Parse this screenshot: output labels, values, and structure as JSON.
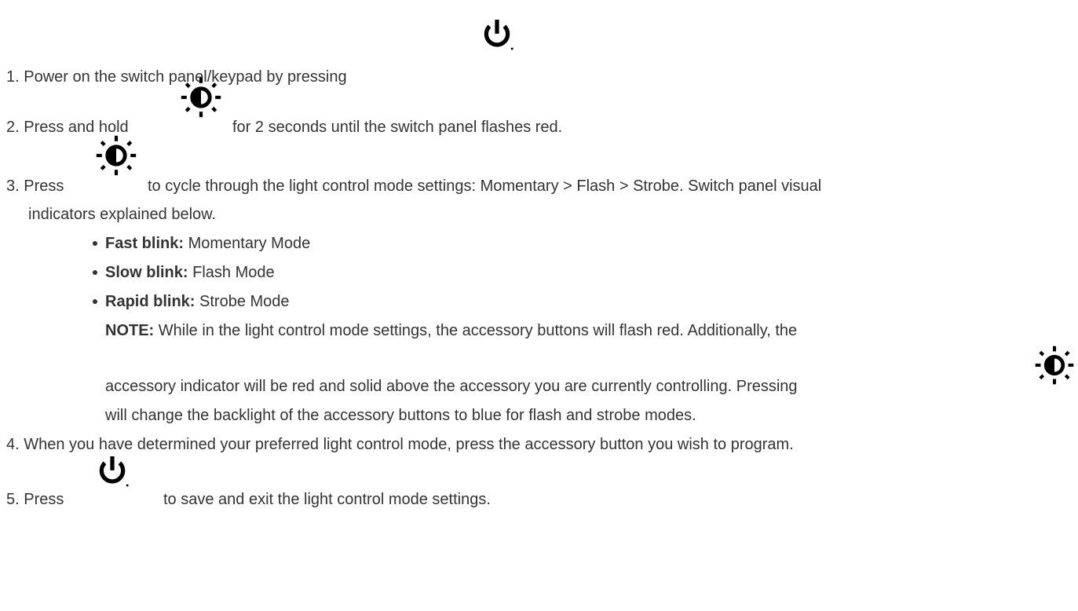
{
  "steps": [
    {
      "number": "1.",
      "text": "Power on the switch panel/keypad by pressing",
      "icon": "power-icon"
    },
    {
      "number": "2.",
      "before": "Press and hold",
      "after": "for 2 seconds until the switch panel flashes red.",
      "icon": "brightness-icon"
    },
    {
      "number": "3.",
      "before": "Press",
      "after": "to cycle through the light control mode settings: Momentary > Flash > Strobe. Switch panel  visual",
      "continuation": "indicators explained below.",
      "icon": "brightness-icon",
      "bullets": [
        {
          "label": "Fast blink:",
          "text": " Momentary Mode"
        },
        {
          "label": "Slow blink:",
          "text": " Flash Mode"
        },
        {
          "label": "Rapid blink:",
          "text": " Strobe Mode"
        }
      ],
      "note": {
        "label": "NOTE:",
        "line1": " While in the light control mode settings, the accessory buttons will flash red. Additionally, the",
        "line2": "accessory indicator will be red and solid above the accessory you are currently controlling. Pressing",
        "line3": "will change the backlight of the accessory buttons to blue for flash and strobe modes.",
        "icon": "brightness-icon"
      }
    },
    {
      "number": "4.",
      "text": "When you have determined your preferred light control mode, press the accessory button you wish to program."
    },
    {
      "number": "5.",
      "before": "Press",
      "after": "to save and exit the light control mode settings.",
      "icon": "power-icon"
    }
  ],
  "colors": {
    "text": "#333333",
    "icon": "#000000"
  }
}
